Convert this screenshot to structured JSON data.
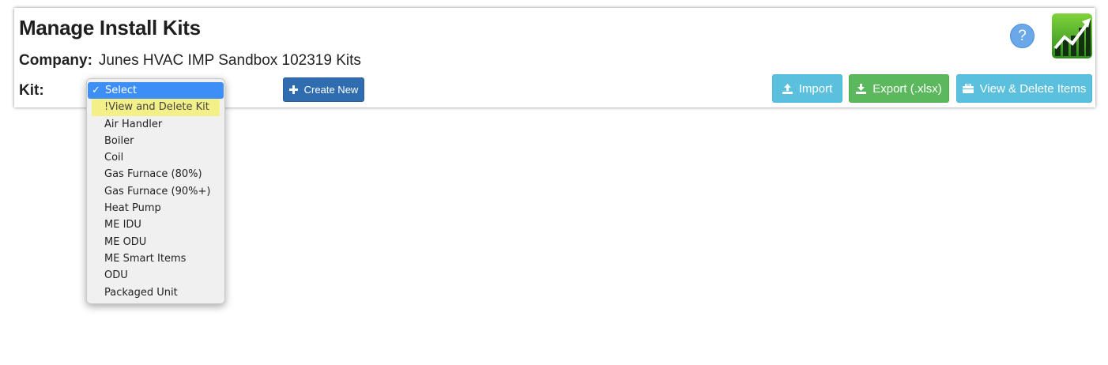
{
  "header": {
    "title": "Manage Install Kits",
    "company_label": "Company:",
    "company_name": "Junes HVAC IMP Sandbox 102319 Kits",
    "kit_label": "Kit:"
  },
  "buttons": {
    "create_new": "Create New",
    "import": "Import",
    "export": "Export (.xlsx)",
    "view_delete": "View & Delete Items",
    "help": "?"
  },
  "kit_select": {
    "selected": "Select",
    "options": [
      "Select",
      "!View and Delete Kit",
      "Air Handler",
      "Boiler",
      "Coil",
      "Gas Furnace (80%)",
      "Gas Furnace (90%+)",
      "Heat Pump",
      "ME IDU",
      "ME ODU",
      "ME Smart Items",
      "ODU",
      "Packaged Unit"
    ]
  },
  "colors": {
    "primary": "#2f6db0",
    "info": "#5bc0de",
    "success": "#5cb85c",
    "select_highlight": "#3d8ef7",
    "hover_highlight": "#f3f08a"
  },
  "icons": {
    "create": "plus-icon",
    "import": "upload-icon",
    "export": "download-icon",
    "view_delete": "briefcase-icon",
    "help": "question-icon",
    "logo": "growth-chart-logo"
  }
}
